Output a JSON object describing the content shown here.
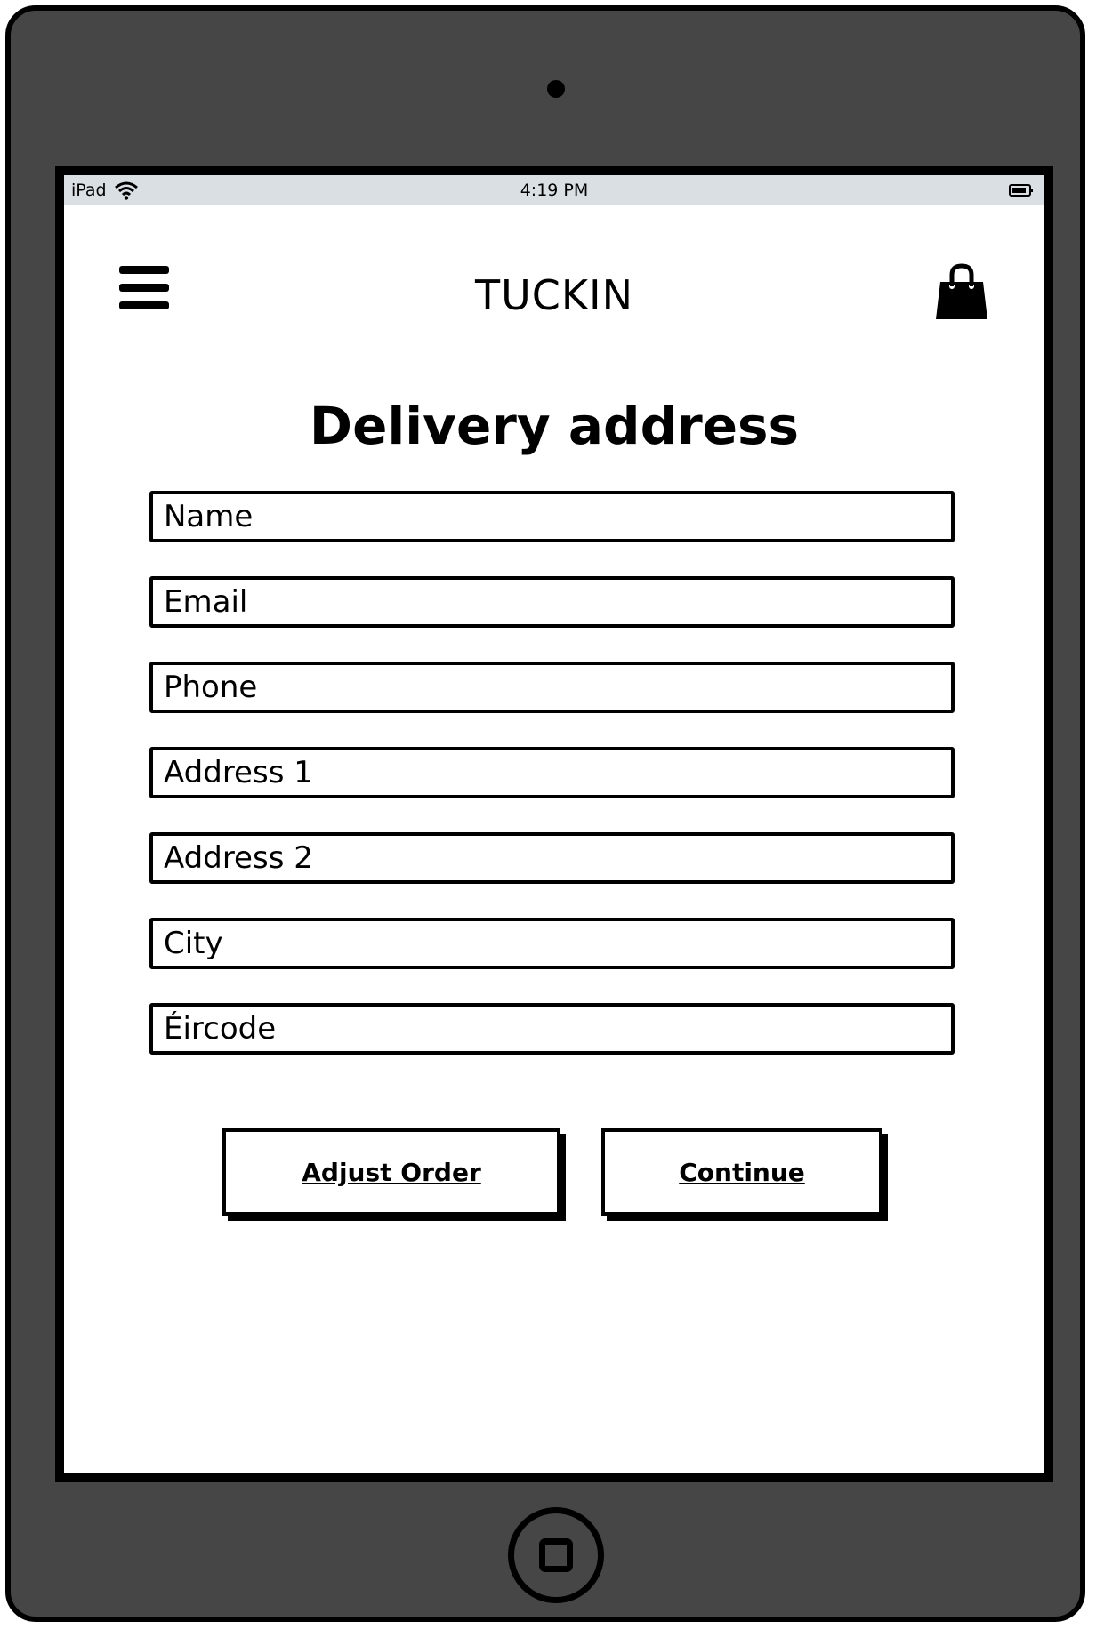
{
  "status_bar": {
    "device": "iPad",
    "time": "4:19 PM"
  },
  "header": {
    "brand": "TUCKIN",
    "menu_icon": "hamburger-menu-icon",
    "cart_icon": "shopping-bag-icon"
  },
  "page": {
    "title": "Delivery address"
  },
  "form": {
    "fields": [
      {
        "placeholder": "Name",
        "value": ""
      },
      {
        "placeholder": "Email",
        "value": ""
      },
      {
        "placeholder": "Phone",
        "value": ""
      },
      {
        "placeholder": "Address 1",
        "value": ""
      },
      {
        "placeholder": "Address 2",
        "value": ""
      },
      {
        "placeholder": "City",
        "value": ""
      },
      {
        "placeholder": "Éircode",
        "value": ""
      }
    ]
  },
  "actions": {
    "adjust_label": "Adjust Order",
    "continue_label": "Continue"
  },
  "colors": {
    "device_body": "#464646",
    "status_bar": "#d9dfe3",
    "screen": "#ffffff",
    "ink": "#000000"
  }
}
